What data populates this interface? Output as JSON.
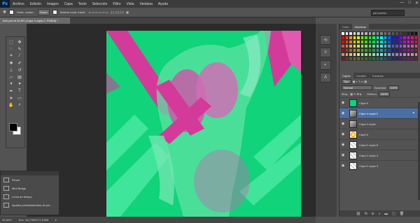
{
  "menubar": {
    "logo": "Ps",
    "items": [
      "Archivo",
      "Edición",
      "Imagen",
      "Capa",
      "Texto",
      "Selección",
      "Filtro",
      "Vista",
      "Ventana",
      "Ayuda"
    ],
    "window_controls": [
      "—",
      "□",
      "✕"
    ]
  },
  "options": {
    "sample_label": "Selec. autom.:",
    "group_value": "Grupo",
    "transform_label": "Mostrar contr. transf.",
    "workspace": "psf pruebo"
  },
  "document": {
    "tab_title": "fucil.psd al 26,8% (Capa 4 copia 2, RGB/8) *",
    "zoom": "26,84%",
    "doc_size": "Doc: 16,0 MB/171,8 MB"
  },
  "history_panel": {
    "items": [
      "Pincel",
      "Mini Bridge",
      "Línea de tiempo",
      "Ajustes preestablecidos de pin..."
    ]
  },
  "right_panel": {
    "swatch_tabs": [
      "Color",
      "Muestras"
    ],
    "layer_tabs": [
      "Capas",
      "Canales",
      "Trazados"
    ],
    "kind_label": "Tipo",
    "blend_mode": "Normal",
    "opacity_label": "Opacidad:",
    "opacity_value": "100%",
    "lock_label": "Bloq.:",
    "fill_label": "Relleno:",
    "fill_value": "100%",
    "layers": [
      {
        "name": "Capa 5",
        "thumb": "green",
        "selected": false,
        "fx": false
      },
      {
        "name": "Capa 4 copia 2",
        "thumb": "photo",
        "selected": true,
        "fx": true
      },
      {
        "name": "Capa 4 copia",
        "thumb": "photo",
        "selected": false,
        "fx": false
      },
      {
        "name": "Capa 6",
        "thumb": "sun",
        "selected": false,
        "fx": false
      },
      {
        "name": "Capa 2 copia 5",
        "thumb": "checker",
        "selected": false,
        "fx": false
      },
      {
        "name": "Capa 2 copia 4",
        "thumb": "checker",
        "selected": false,
        "fx": false
      },
      {
        "name": "Capa 2 copia 3",
        "thumb": "checker",
        "selected": false,
        "fx": false
      }
    ]
  },
  "colors": {
    "canvas_green": "#10d37a",
    "canvas_magenta": "#d43a9a",
    "selection_blue": "#4a6fa5"
  }
}
